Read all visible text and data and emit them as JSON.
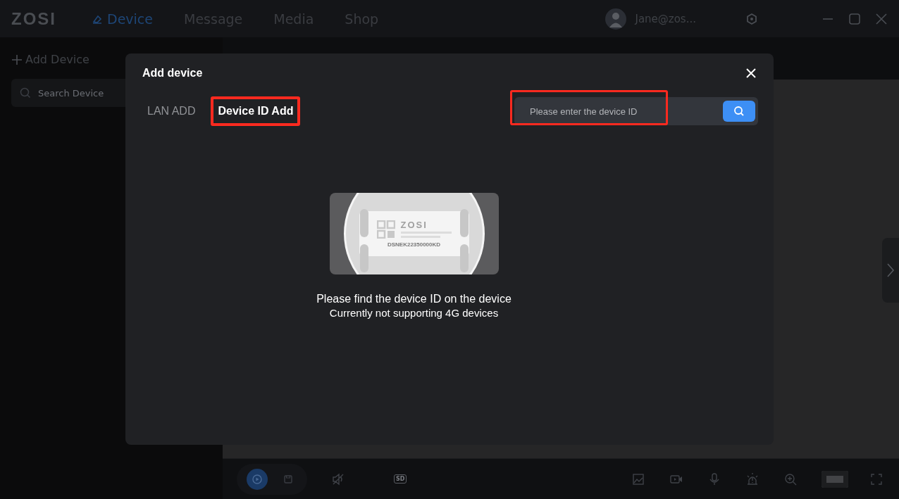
{
  "app": {
    "logo": "ZOSI",
    "nav": [
      {
        "label": "Device",
        "selected": true
      },
      {
        "label": "Message",
        "selected": false
      },
      {
        "label": "Media",
        "selected": false
      },
      {
        "label": "Shop",
        "selected": false
      }
    ],
    "user": "Jane@zos..."
  },
  "sidebar": {
    "add_label": "Add Device",
    "search": {
      "placeholder": "Search Device"
    }
  },
  "toolbar": {
    "quality": "SD"
  },
  "dialog": {
    "title": "Add device",
    "tabs": [
      {
        "label": "LAN ADD",
        "selected": false,
        "highlighted": false
      },
      {
        "label": "Device ID Add",
        "selected": true,
        "highlighted": true
      }
    ],
    "id_field": {
      "placeholder": "Please enter the device ID",
      "highlighted": true
    },
    "illustration": {
      "brand": "ZOSI",
      "serial": "DSNEK22350000KD"
    },
    "hint": "Please find the device ID on the device",
    "note": "Currently not supporting 4G devices"
  }
}
